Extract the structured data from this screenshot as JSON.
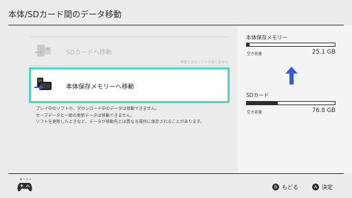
{
  "header": {
    "title": "本体/SDカード間のデータ移動"
  },
  "options": {
    "sd_move": {
      "label": "SDカードへ移動",
      "note": "移動できるソフトがありません"
    },
    "system_move": {
      "label": "本体保存メモリーへ移動"
    }
  },
  "description": {
    "lines": [
      "プレイ中のソフトや、ダウンロード中のデータは移動できません。",
      "セーブデータと一部の更新データは移動できません。",
      "ソフトを更新したときなど、データが移動先とは異なる場所に保存されることがあります。"
    ]
  },
  "storage": {
    "system": {
      "title": "本体保存メモリー",
      "free_label": "空き容量",
      "free_value": "25.1 GB",
      "used_fraction": 0.03
    },
    "sd": {
      "title": "SDカード",
      "free_label": "空き容量",
      "free_value": "76.8 GB",
      "used_fraction": 0.35
    }
  },
  "footer": {
    "back": {
      "button": "B",
      "label": "もどる"
    },
    "confirm": {
      "button": "A",
      "label": "決定"
    }
  },
  "colors": {
    "accent": "#49d6c6",
    "arrow": "#2f5fd0",
    "joycon_blue": "#3a5bd9",
    "player_led": "#3fc86d"
  },
  "icons": {
    "sd_option": "sd-card-move-icon",
    "system_option": "console-move-icon",
    "arrow": "arrow-up-icon",
    "controller": "pro-controller-icon"
  }
}
